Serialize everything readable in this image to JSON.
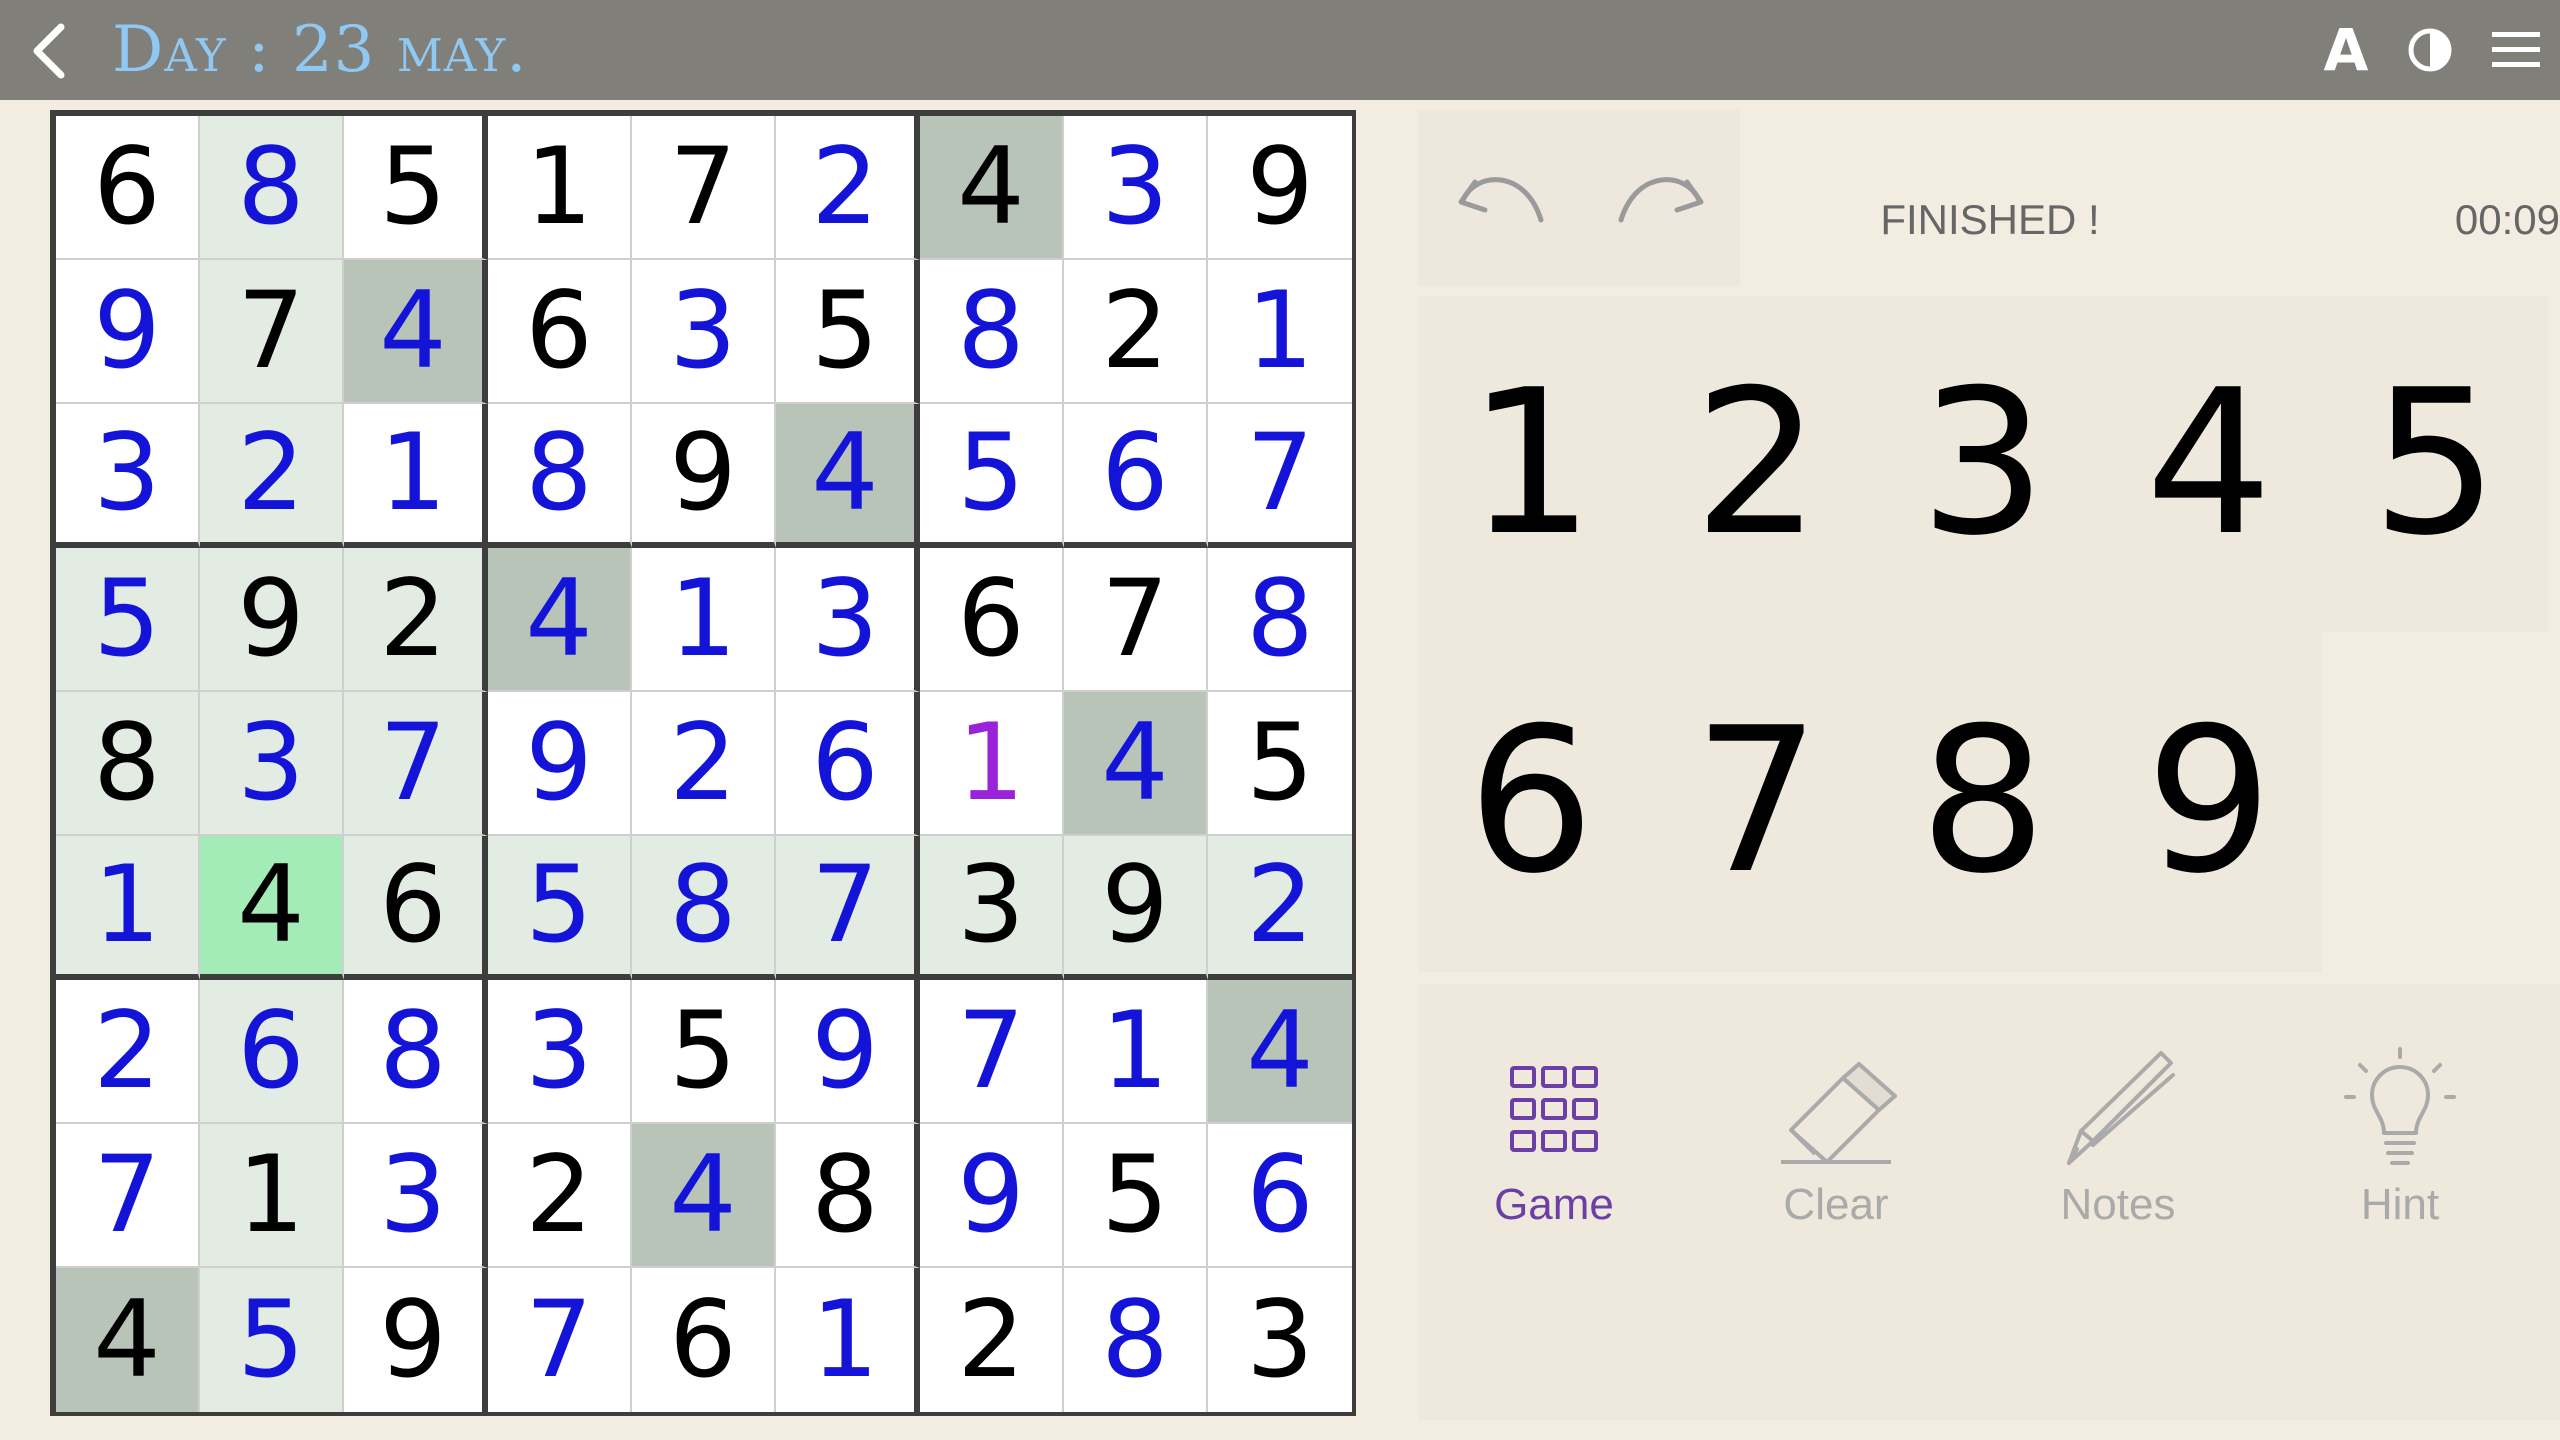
{
  "header": {
    "title": "Day : 23 may.",
    "font_icon": "A"
  },
  "board": {
    "cells": [
      [
        6,
        8,
        5,
        1,
        7,
        2,
        4,
        3,
        9
      ],
      [
        9,
        7,
        4,
        6,
        3,
        5,
        8,
        2,
        1
      ],
      [
        3,
        2,
        1,
        8,
        9,
        4,
        5,
        6,
        7
      ],
      [
        5,
        9,
        2,
        4,
        1,
        3,
        6,
        7,
        8
      ],
      [
        8,
        3,
        7,
        9,
        2,
        6,
        1,
        4,
        5
      ],
      [
        1,
        4,
        6,
        5,
        8,
        7,
        3,
        9,
        2
      ],
      [
        2,
        6,
        8,
        3,
        5,
        9,
        7,
        1,
        4
      ],
      [
        7,
        1,
        3,
        2,
        4,
        8,
        9,
        5,
        6
      ],
      [
        4,
        5,
        9,
        7,
        6,
        1,
        2,
        8,
        3
      ]
    ],
    "kind": [
      "GUGGGUGUG",
      "UGUGUGUGU",
      "UUUUGUUUU",
      "UGGUUUGGU",
      "GUUUUUUUG",
      "UGGUUUGGU",
      "UUUUGUUUU",
      "UGUGUGUGU",
      "GUGUGUGUG"
    ],
    "special": {
      "4,6": "purple"
    },
    "colors": {
      "given": "#000000",
      "user": "#1414d8",
      "special": "#9a22d8",
      "empty_bg": "#ffffff",
      "related_bg": "#e3ece3",
      "same_digit_bg": "#b9c4b9",
      "selected_bg": "#a3ecb8"
    },
    "selected": [
      5,
      1
    ]
  },
  "status": {
    "text": "FINISHED !",
    "timer": "00:09"
  },
  "numpad": {
    "keys": [
      "1",
      "2",
      "3",
      "4",
      "5",
      "6",
      "7",
      "8",
      "9"
    ]
  },
  "tools": [
    {
      "name": "game",
      "label": "Game",
      "icon": "grid-icon",
      "color": "#6c3fa6"
    },
    {
      "name": "clear",
      "label": "Clear",
      "icon": "eraser-icon",
      "color": "#aaaaaa"
    },
    {
      "name": "notes",
      "label": "Notes",
      "icon": "pencil-icon",
      "color": "#aaaaaa"
    },
    {
      "name": "hint",
      "label": "Hint",
      "icon": "lightbulb-icon",
      "color": "#aaaaaa"
    }
  ]
}
